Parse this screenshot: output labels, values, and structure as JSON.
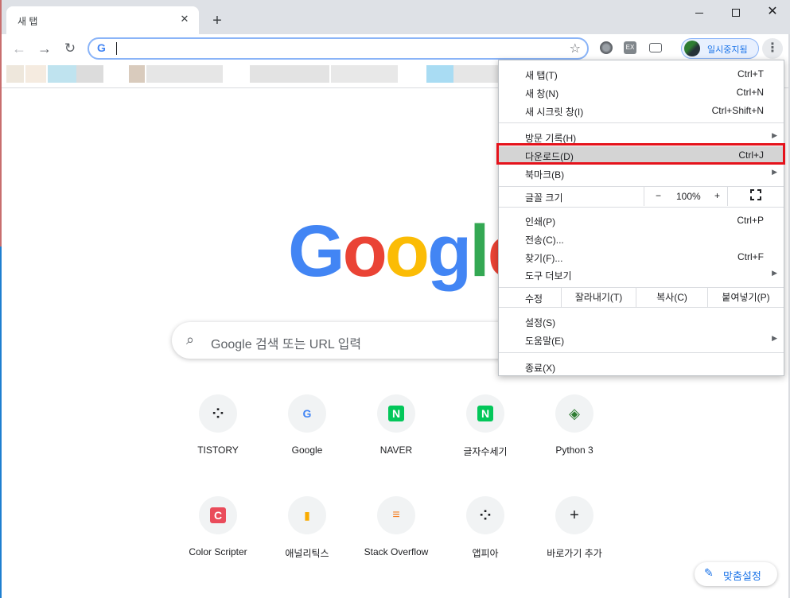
{
  "window": {
    "tab_title": "새 탭",
    "tab_close": "✕",
    "new_tab": "+",
    "close_glyph": "✕"
  },
  "toolbar": {
    "back": "←",
    "forward": "→",
    "reload": "↻",
    "omnibox_value": "",
    "omnibox_g": "G",
    "star": "☆",
    "ext2_label": "EX",
    "profile_label": "일시중지됨",
    "menu_dots": "⋮"
  },
  "logo": [
    "G",
    "o",
    "o",
    "g",
    "l",
    "e"
  ],
  "logo_colors": [
    "#4285f4",
    "#ea4335",
    "#fbbc05",
    "#4285f4",
    "#34a853",
    "#ea4335"
  ],
  "search": {
    "icon": "⌕",
    "placeholder": "Google 검색 또는 URL 입력"
  },
  "tiles": [
    {
      "label": "TISTORY",
      "glyph": "⁘",
      "color": "#202124"
    },
    {
      "label": "Google",
      "glyph": "G",
      "color": "#4285f4"
    },
    {
      "label": "NAVER",
      "glyph": "N",
      "color": "#ffffff"
    },
    {
      "label": "글자수세기",
      "glyph": "N",
      "color": "#ffffff"
    },
    {
      "label": "Python 3",
      "glyph": "◈",
      "color": "#2e7d32"
    },
    {
      "label": "Color Scripter",
      "glyph": "C",
      "color": "#ffffff"
    },
    {
      "label": "애널리틱스",
      "glyph": "▮",
      "color": "#f9ab00"
    },
    {
      "label": "Stack Overflow",
      "glyph": "≡",
      "color": "#f48024"
    },
    {
      "label": "앱피아",
      "glyph": "⁘",
      "color": "#202124"
    },
    {
      "label": "바로가기 추가",
      "glyph": "+",
      "color": "#202124"
    }
  ],
  "customize": {
    "icon": "✎",
    "label": "맞춤설정"
  },
  "menu": {
    "items": [
      {
        "label": "새 탭(T)",
        "shortcut": "Ctrl+T"
      },
      {
        "label": "새 창(N)",
        "shortcut": "Ctrl+N"
      },
      {
        "label": "새 시크릿 창(I)",
        "shortcut": "Ctrl+Shift+N"
      },
      {
        "label": "방문 기록(H)",
        "shortcut": ""
      },
      {
        "label": "다운로드(D)",
        "shortcut": "Ctrl+J"
      },
      {
        "label": "북마크(B)",
        "shortcut": ""
      },
      {
        "label": "인쇄(P)",
        "shortcut": "Ctrl+P"
      },
      {
        "label": "전송(C)...",
        "shortcut": ""
      },
      {
        "label": "찾기(F)...",
        "shortcut": "Ctrl+F"
      },
      {
        "label": "도구 더보기",
        "shortcut": ""
      },
      {
        "label": "설정(S)",
        "shortcut": ""
      },
      {
        "label": "도움말(E)",
        "shortcut": ""
      },
      {
        "label": "종료(X)",
        "shortcut": ""
      }
    ],
    "submenu_arrow": "▶",
    "zoom": {
      "label": "글꼴 크기",
      "minus": "−",
      "value": "100%",
      "plus": "+"
    },
    "edit": {
      "label": "수정",
      "cut": "잘라내기(T)",
      "copy": "복사(C)",
      "paste": "붙여넣기(P)"
    },
    "highlight_color": "#e5121b"
  }
}
